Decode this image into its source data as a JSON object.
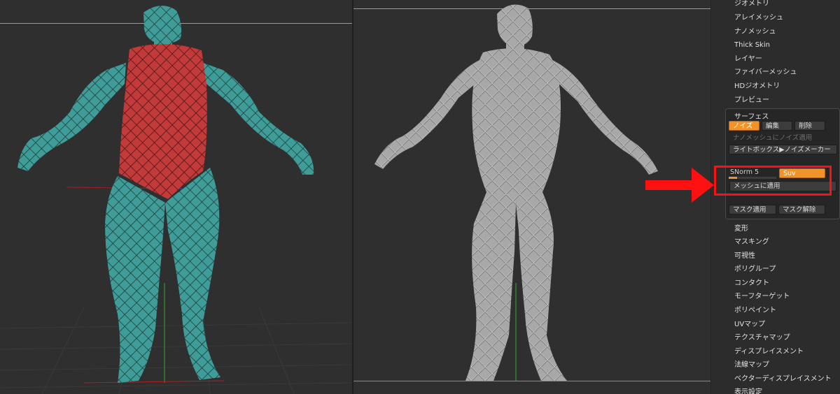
{
  "panel": {
    "items_top": [
      "ジオメトリ",
      "アレイメッシュ",
      "ナノメッシュ",
      "Thick Skin",
      "レイヤー",
      "ファイバーメッシュ",
      "HDジオメトリ",
      "プレビュー"
    ],
    "surface": {
      "title": "サーフェス",
      "noise_button": "ノイズ",
      "edit_button": "編集",
      "delete_button": "削除",
      "nanomesh_noise": "ナノメッシュにノイズ適用",
      "lightbox_button": "ライトボックス▶ノイズメーカー",
      "snorm_label": "SNorm 5",
      "snorm_value": 0.05,
      "suv_button": "Suv",
      "apply_mesh_button": "メッシュに適用",
      "mask_apply_button": "マスク適用",
      "mask_clear_button": "マスク解除"
    },
    "items_bottom": [
      "変形",
      "マスキング",
      "可視性",
      "ポリグループ",
      "コンタクト",
      "モーフターゲット",
      "ポリペイント",
      "UVマップ",
      "テクスチャマップ",
      "ディスプレイスメント",
      "法線マップ",
      "ベクターディスプレイスメント",
      "表示設定"
    ]
  },
  "colors": {
    "teal_skin": "#3f9c98",
    "red_polygroup": "#c23a3a",
    "gray_skin": "#a8a8a8",
    "accent_orange": "#f0932a",
    "highlight_red": "#ff1010"
  }
}
